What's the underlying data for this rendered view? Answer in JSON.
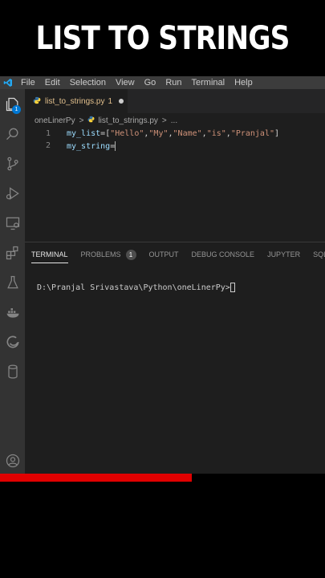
{
  "headline": "LIST TO STRINGS",
  "menu": [
    "File",
    "Edit",
    "Selection",
    "View",
    "Go",
    "Run",
    "Terminal",
    "Help"
  ],
  "activity_badge": "1",
  "tab": {
    "label": "list_to_strings.py",
    "problems": "1"
  },
  "breadcrumb": {
    "folder": "oneLinerPy",
    "sep": ">",
    "file": "list_to_strings.py",
    "sep2": ">",
    "more": "..."
  },
  "editor": {
    "lines": [
      {
        "num": "1",
        "var": "my_list",
        "eq": "=",
        "open": "[",
        "items": [
          "\"Hello\"",
          "\"My\"",
          "\"Name\"",
          "\"is\"",
          "\"Pranjal\""
        ],
        "close": "]"
      },
      {
        "num": "2",
        "var": "my_string",
        "eq": "="
      }
    ],
    "comma": ","
  },
  "panel": {
    "tabs": [
      "TERMINAL",
      "PROBLEMS",
      "OUTPUT",
      "DEBUG CONSOLE",
      "JUPYTER",
      "SQL CONS"
    ],
    "problems_count": "1",
    "terminal_prompt": "D:\\Pranjal Srivastava\\Python\\oneLinerPy>"
  },
  "video_progress": 0.59,
  "colors": {
    "accent": "#0078d4",
    "progress": "#e00000",
    "string": "#ce9178",
    "variable": "#9cdcfe"
  }
}
